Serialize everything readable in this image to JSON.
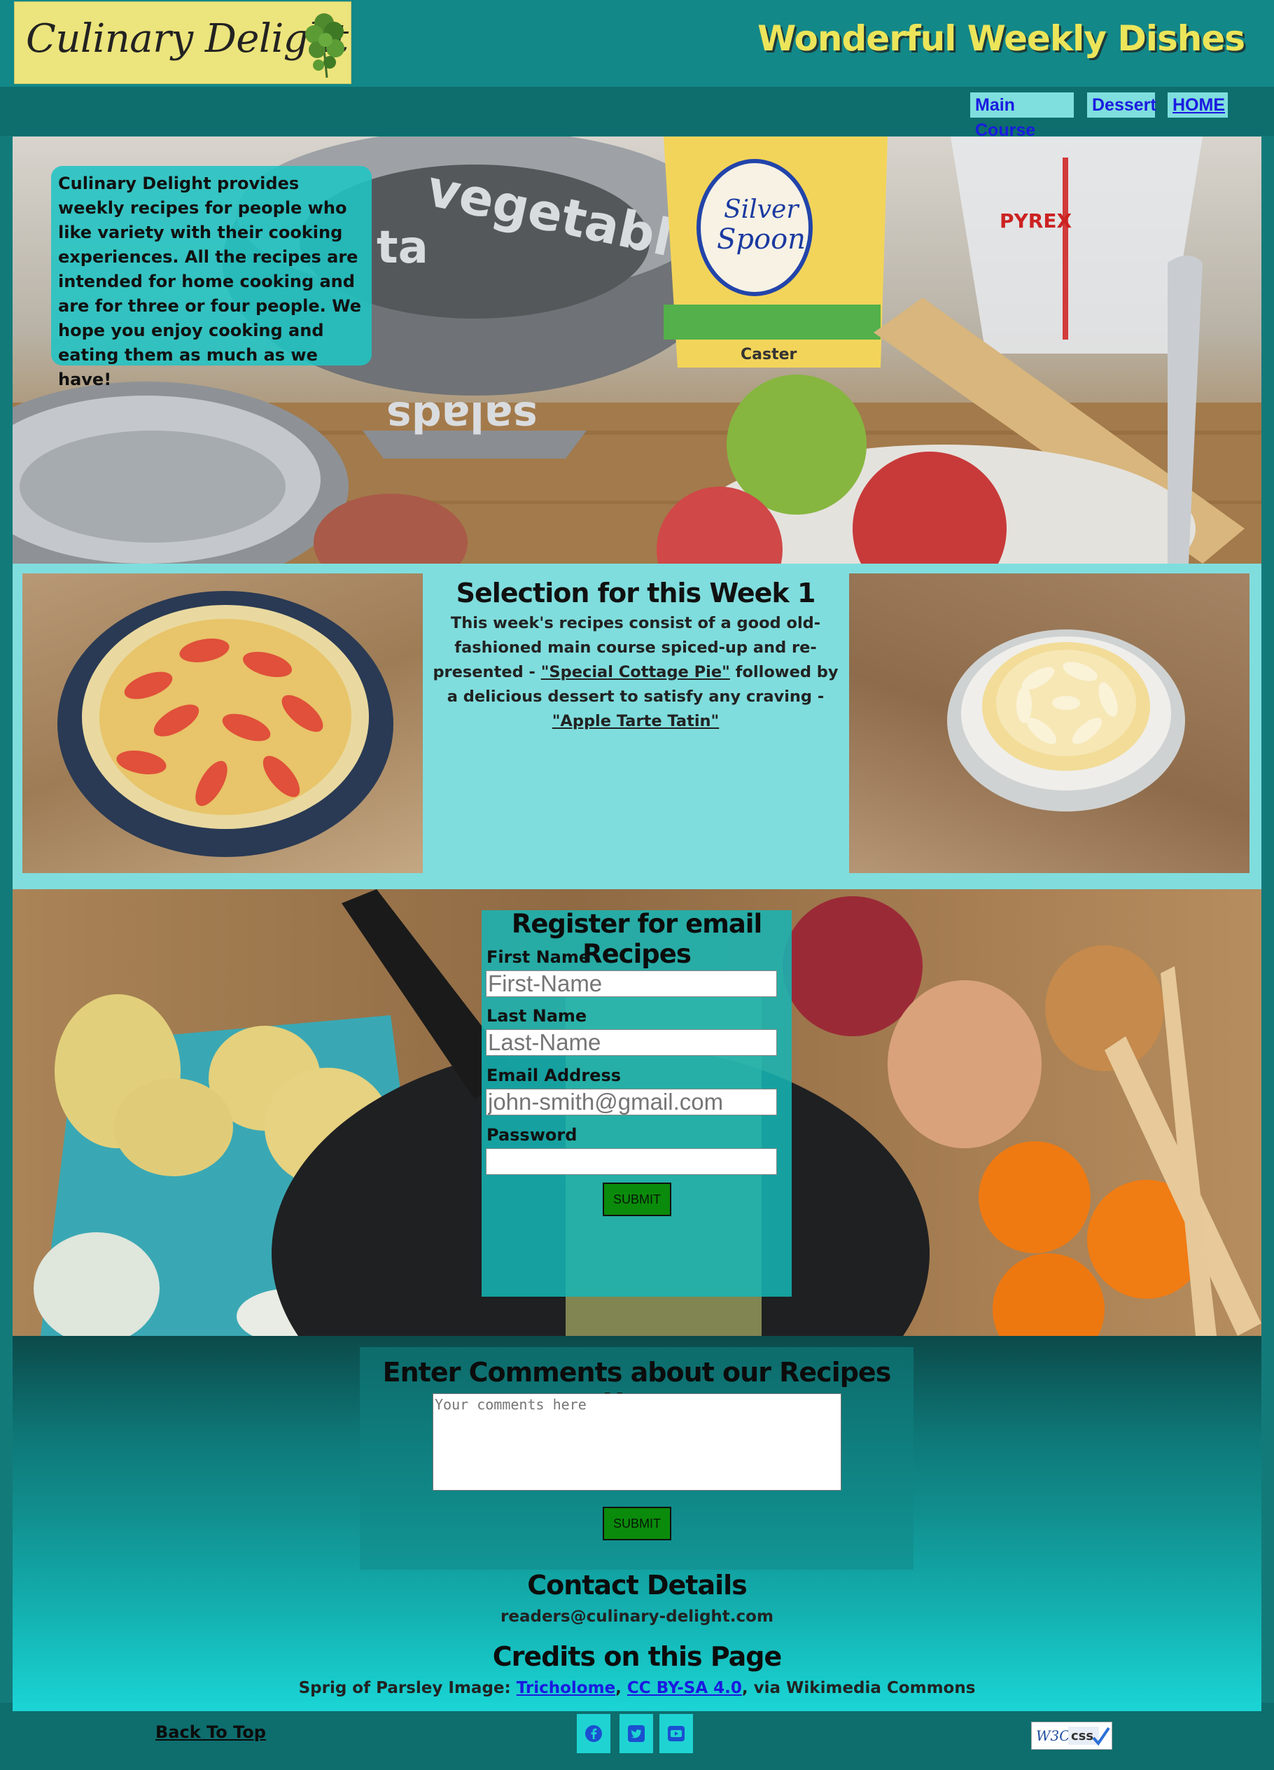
{
  "header": {
    "logo_text": "Culinary Delight",
    "site_title": "Wonderful Weekly Dishes"
  },
  "nav": {
    "items": [
      {
        "label": "Main Course"
      },
      {
        "label": "Dessert"
      },
      {
        "label": "HOME"
      }
    ]
  },
  "intro": {
    "text": "Culinary Delight provides weekly recipes for people who like variety with their cooking experiences. All the recipes are intended for home cooking and are for three or four people. We hope you enjoy cooking and eating them as much as we have!"
  },
  "hero_image": {
    "bowl_text_top": "vegetables",
    "bowl_text_bottom": "salads",
    "bowl_text_side": "ta",
    "bag_brand_line1": "Silver",
    "bag_brand_line2": "Spoon",
    "bag_caster": "Caster",
    "jug_brand": "PYREX"
  },
  "selection": {
    "title": "Selection for this Week 1",
    "text_part1": "This week's recipes consist of a good old-fashioned main course spiced-up and re-presented - ",
    "link_main": "\"Special Cottage Pie\"",
    "text_part2": " followed by a delicious dessert to satisfy any craving - ",
    "link_dessert": "\"Apple Tarte Tatin\""
  },
  "register": {
    "title": "Register for email Recipes",
    "first_name_label": "First Name",
    "first_name_placeholder": "First-Name",
    "last_name_label": "Last Name",
    "last_name_placeholder": "Last-Name",
    "email_label": "Email Address",
    "email_placeholder": "john-smith@gmail.com",
    "password_label": "Password",
    "submit_label": "SUBMIT"
  },
  "comments": {
    "title": "Enter Comments about our Recipes Here",
    "placeholder": "Your comments here",
    "submit_label": "SUBMIT"
  },
  "contact": {
    "title": "Contact Details",
    "email": "readers@culinary-delight.com"
  },
  "credits": {
    "title": "Credits on this Page",
    "prefix": "Sprig of Parsley Image: ",
    "author": "Tricholome",
    "sep1": ", ",
    "license": "CC BY-SA 4.0",
    "suffix": ", via Wikimedia Commons"
  },
  "footer": {
    "back_to_top": "Back To Top",
    "social_icons": [
      "facebook-icon",
      "twitter-icon",
      "youtube-icon"
    ],
    "badge_w3c": "W3C",
    "badge_css": "css"
  },
  "colors": {
    "header_bg": "#138888",
    "nav_bg": "#0e6d6d",
    "title_yellow": "#ece55a",
    "logo_bg": "#ece47c",
    "accent_cyan": "#80dddd",
    "link_blue": "#1a1ae0",
    "submit_green": "#0b8b0b"
  }
}
